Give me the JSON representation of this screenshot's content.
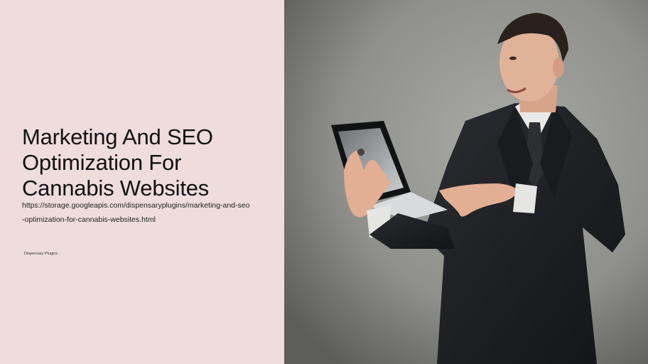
{
  "page": {
    "title_lines": [
      "Marketing And SEO",
      "Optimization For",
      "Cannabis Websites"
    ],
    "url_lines": [
      "https://storage.googleapis.com/dispensaryplugins/marketing-and-seo",
      "-optimization-for-cannabis-websites.html"
    ],
    "brand": "Dispensary Plugins"
  },
  "colors": {
    "left_background": "#efdcdc",
    "photo_background": "#8f908c",
    "suit": "#1f2024"
  },
  "photo": {
    "icon": "businessman-with-tablet-photo"
  }
}
